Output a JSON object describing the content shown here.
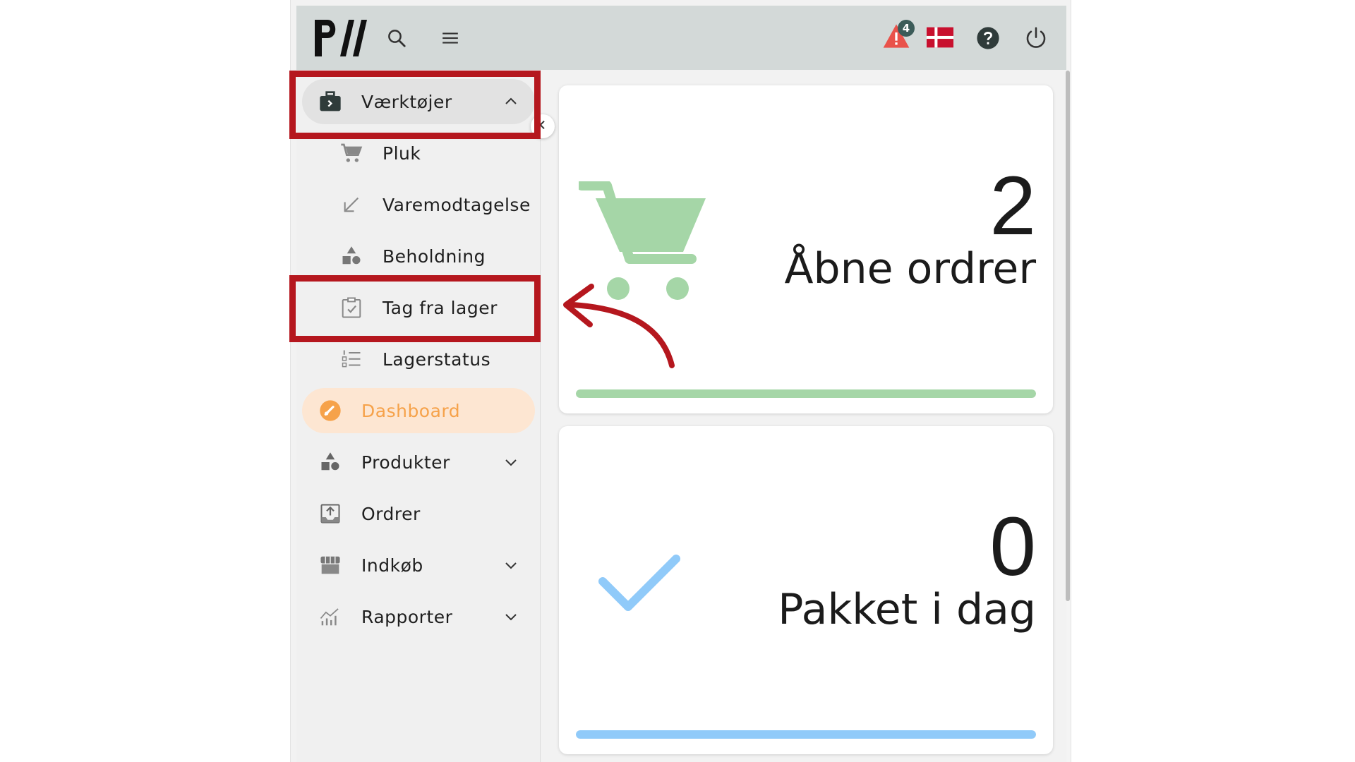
{
  "topbar": {
    "logo_text": "PW",
    "notification_count": "4",
    "icons": [
      "search-icon",
      "menu-icon",
      "alert-icon",
      "danish-flag-icon",
      "help-icon",
      "power-icon"
    ]
  },
  "sidebar": {
    "items": [
      {
        "label": "Værktøjer",
        "icon": "toolbox-icon",
        "state": "expanded"
      },
      {
        "label": "Pluk",
        "icon": "cart-icon",
        "sub": true
      },
      {
        "label": "Varemodtagelse",
        "icon": "arrow-down-left-icon",
        "sub": true
      },
      {
        "label": "Beholdning",
        "icon": "shapes-icon",
        "sub": true
      },
      {
        "label": "Tag fra lager",
        "icon": "clipboard-check-icon",
        "sub": true
      },
      {
        "label": "Lagerstatus",
        "icon": "numbered-list-icon",
        "sub": true
      },
      {
        "label": "Dashboard",
        "icon": "gauge-icon",
        "state": "active"
      },
      {
        "label": "Produkter",
        "icon": "shapes-icon",
        "state": "collapsed"
      },
      {
        "label": "Ordrer",
        "icon": "upload-box-icon"
      },
      {
        "label": "Indkøb",
        "icon": "store-icon",
        "state": "collapsed"
      },
      {
        "label": "Rapporter",
        "icon": "chart-icon",
        "state": "collapsed"
      }
    ]
  },
  "cards": [
    {
      "value": "2",
      "label": "Åbne ordrer",
      "icon": "cart-icon",
      "color": "#a5d6a7",
      "progress": 1.0
    },
    {
      "value": "0",
      "label": "Pakket i dag",
      "icon": "check-icon",
      "color": "#90caf9",
      "progress": 1.0
    }
  ],
  "colors": {
    "topbar": "#d3d9d8",
    "active_bg": "#fde6d2",
    "active_text": "#f6a24a",
    "highlight": "#b5171e"
  }
}
